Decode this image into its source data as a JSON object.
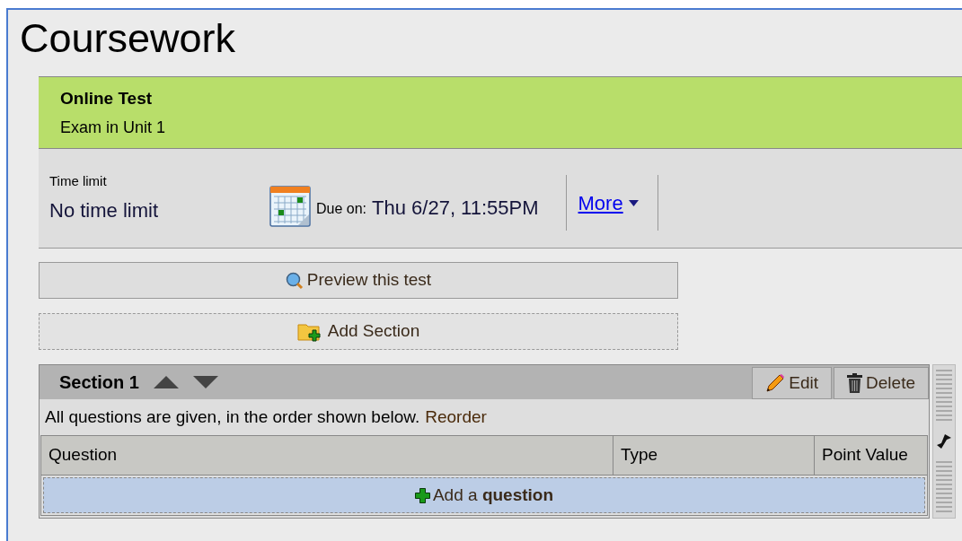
{
  "page": {
    "title": "Coursework"
  },
  "assignment": {
    "type": "Online Test",
    "name": "Exam in Unit 1"
  },
  "details": {
    "time_limit_label": "Time limit",
    "time_limit": "No time limit",
    "due_label": "Due on:",
    "due": "Thu 6/27, 11:55PM",
    "more_link": "More"
  },
  "actions": [
    {
      "kind": "preview",
      "label": "Preview this test"
    },
    {
      "kind": "add-section",
      "label": "Add Section"
    }
  ],
  "section": {
    "title": "Section 1",
    "buttons": [
      {
        "kind": "edit",
        "label": "Edit"
      },
      {
        "kind": "delete",
        "label": "Delete"
      }
    ],
    "order_note": "All questions are given, in the order shown below.",
    "reorder_link": "Reorder",
    "table": {
      "columns": [
        "Question",
        "Type",
        "Point Value"
      ]
    },
    "add_question": "Add a **question**"
  }
}
